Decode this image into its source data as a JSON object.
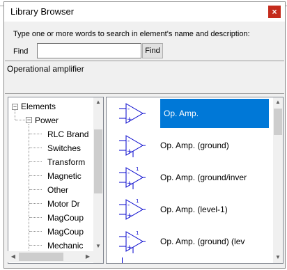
{
  "window": {
    "title": "Library Browser",
    "close_glyph": "×"
  },
  "search": {
    "instructions": "Type one or more words to search in element's name and  description:",
    "find_label": "Find",
    "find_value": "",
    "find_button": "Find"
  },
  "description": "Operational amplifier",
  "tree": {
    "root": "Elements",
    "group": "Power",
    "items": [
      "RLC Brand",
      "Switches",
      "Transform",
      "Magnetic",
      "Other",
      "Motor Dr",
      "MagCoup",
      "MagCoup",
      "Mechanic"
    ]
  },
  "list": {
    "items": [
      {
        "label": "Op. Amp.",
        "icon": "opamp-icon",
        "selected": true
      },
      {
        "label": "Op. Amp. (ground)",
        "icon": "opamp-ground-icon",
        "selected": false
      },
      {
        "label": "Op. Amp. (ground/inver",
        "icon": "opamp-ground-inverting-icon",
        "selected": false
      },
      {
        "label": "Op. Amp. (level-1)",
        "icon": "opamp-level1-icon",
        "selected": false
      },
      {
        "label": "Op. Amp. (ground) (lev",
        "icon": "opamp-ground-level-icon",
        "selected": false
      }
    ]
  },
  "colors": {
    "selection": "#0078d7",
    "icon_stroke": "#0000cc",
    "close_button": "#c42b1c"
  }
}
